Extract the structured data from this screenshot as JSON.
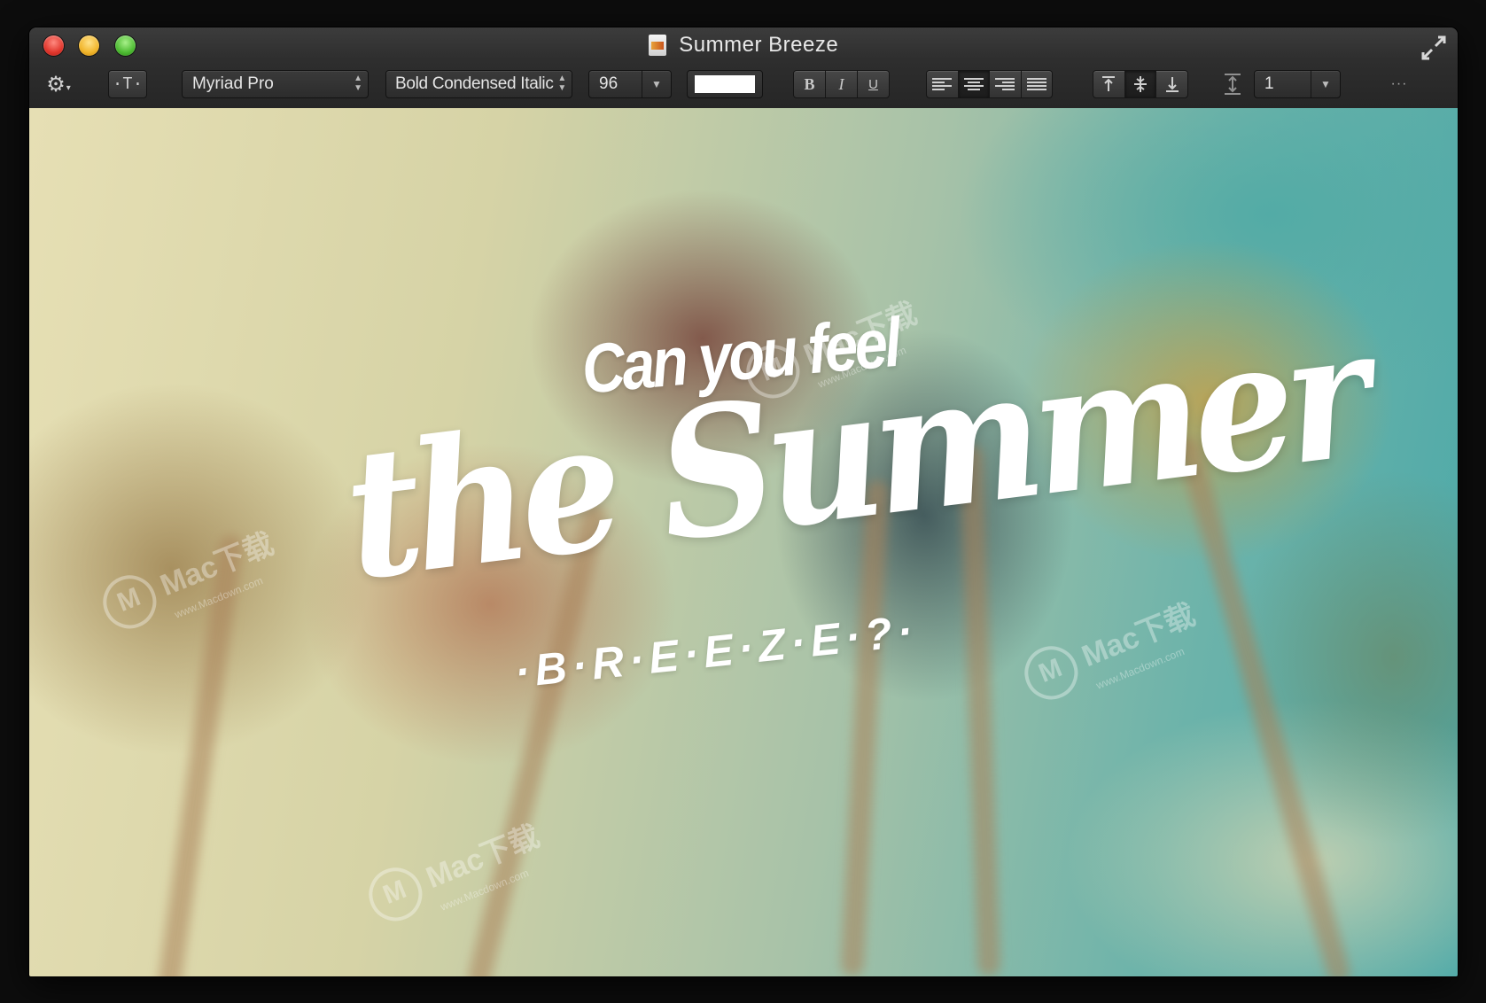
{
  "window": {
    "title": "Summer Breeze"
  },
  "toolbar": {
    "gear_symbol": "⚙",
    "textbox_symbol": "·T·",
    "font_family": "Myriad Pro",
    "font_style": "Bold Condensed Italic",
    "font_size": "96",
    "text_color": "#ffffff",
    "style_bold": "B",
    "style_italic": "I",
    "style_underline": "U",
    "line_spacing": "1",
    "more": "···"
  },
  "canvas": {
    "line1": "Can you feel",
    "line2": "the Summer",
    "line3": "·B·R·E·E·Z·E·?·"
  },
  "watermark": {
    "brand": "Mac下载",
    "site": "www.Macdown.com"
  },
  "colors": {
    "close": "#e0362c",
    "minimize": "#f1b52a",
    "zoom": "#4dbb32"
  }
}
